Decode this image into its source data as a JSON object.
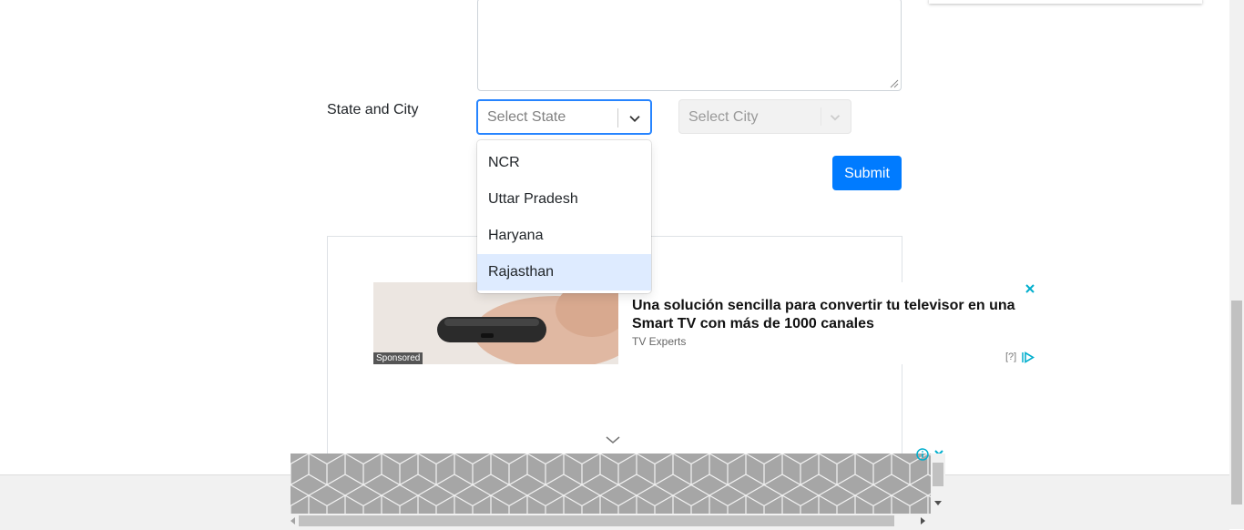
{
  "form": {
    "state_city_label": "State and City",
    "state_placeholder": "Select State",
    "city_placeholder": "Select City",
    "submit_label": "Submit"
  },
  "state_menu": {
    "options": [
      "NCR",
      "Uttar Pradesh",
      "Haryana",
      "Rajasthan"
    ],
    "focused_option": "Rajasthan"
  },
  "ad": {
    "sponsored_label": "Sponsored",
    "title": "Una solución sencilla para convertir tu televisor en una Smart TV con más de 1000 canales",
    "source": "TV Experts",
    "help_label": "[?]"
  },
  "colors": {
    "primary": "#007bff",
    "focus_border": "#2684ff",
    "option_focus": "#deebff",
    "ad_close": "#00aecd"
  }
}
